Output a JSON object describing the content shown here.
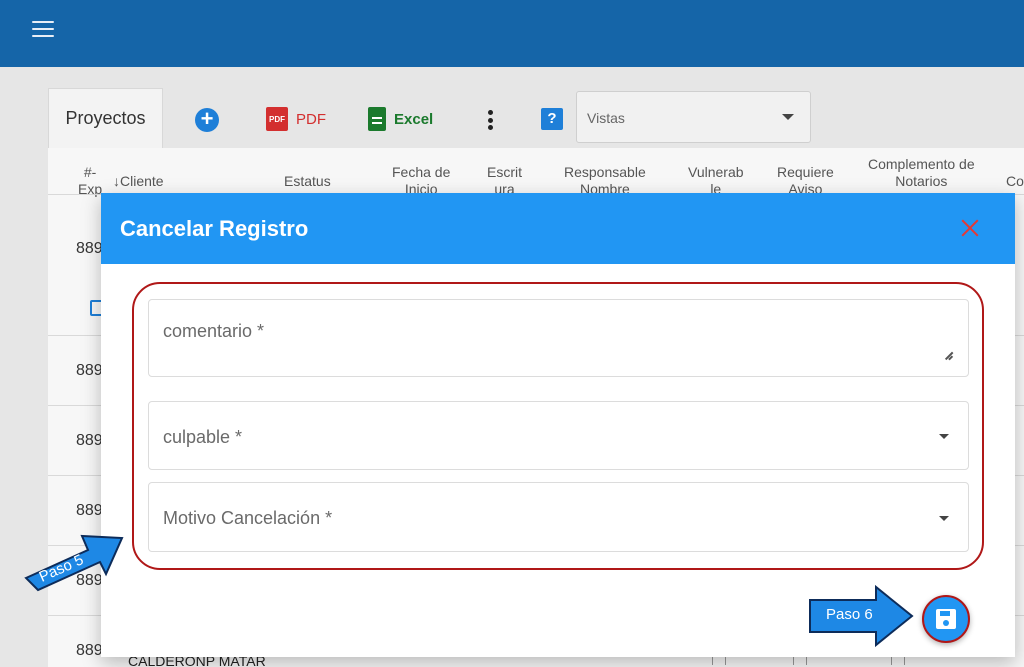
{
  "toolbar": {
    "tab_label": "Proyectos",
    "add_symbol": "+",
    "pdf_icon_text": "PDF",
    "pdf_label": "PDF",
    "excel_label": "Excel",
    "help_symbol": "?",
    "vistas_placeholder": "Vistas"
  },
  "table": {
    "headers": [
      {
        "label": "#-\nExp"
      },
      {
        "label": "↓Cliente"
      },
      {
        "label": "Estatus"
      },
      {
        "label": "Fecha de\nInicio"
      },
      {
        "label": "Escrit\nura"
      },
      {
        "label": "Responsable\nNombre"
      },
      {
        "label": "Vulnerab\nle"
      },
      {
        "label": "Requiere\nAviso"
      },
      {
        "label": "Complemento de\nNotarios"
      },
      {
        "label": "Co"
      }
    ],
    "row_ids": [
      "889",
      "889",
      "889",
      "889",
      "889",
      "889"
    ],
    "last_row_text": "CALDERONP MATAR"
  },
  "modal": {
    "title": "Cancelar Registro",
    "fields": {
      "comentario": "comentario *",
      "culpable": "culpable *",
      "motivo": "Motivo Cancelación *"
    }
  },
  "annotations": {
    "paso5": "Paso 5",
    "paso6": "Paso 6"
  },
  "colors": {
    "appbar": "#1565a8",
    "modal_header": "#2196f3",
    "highlight": "#b01818",
    "close": "#e53935"
  }
}
